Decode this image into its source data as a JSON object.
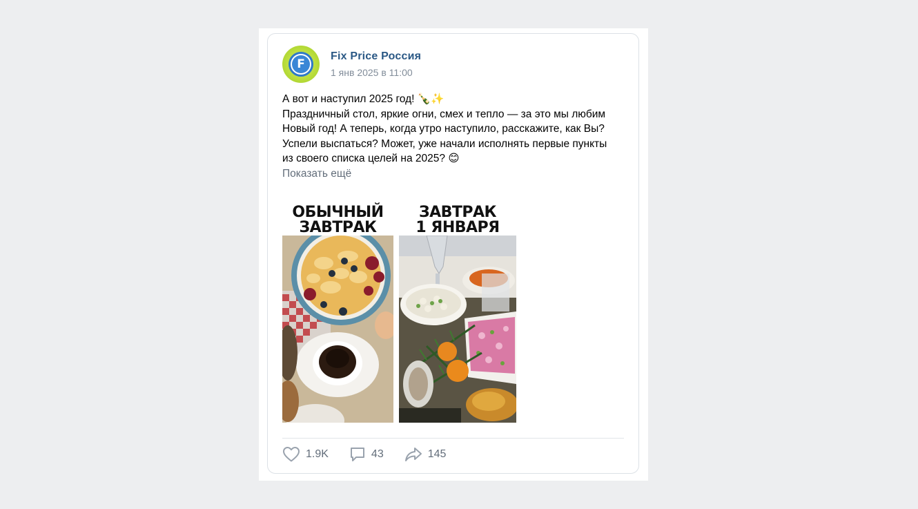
{
  "post": {
    "author": "Fix Price Россия",
    "date": "1 янв 2025 в 11:00",
    "avatar_letter": "F",
    "text_lines": [
      "А вот и наступил 2025 год! 🍾✨",
      "Праздничный стол, яркие огни, смех и тепло — за это мы любим",
      "Новый год! А теперь, когда утро наступило, расскажите, как Вы?",
      "Успели выспаться? Может, уже начали исполнять первые пункты",
      "из своего списка целей на 2025? 😊"
    ],
    "show_more": "Показать ещё",
    "images": [
      {
        "title_line1": "ОБЫЧНЫЙ",
        "title_line2": "ЗАВТРАК"
      },
      {
        "title_line1": "ЗАВТРАК",
        "title_line2": "1 ЯНВАРЯ"
      }
    ]
  },
  "actions": {
    "likes": "1.9K",
    "comments": "43",
    "shares": "145"
  },
  "colors": {
    "author": "#2a5885",
    "muted": "#818c99",
    "background": "#edeef0"
  },
  "icons": [
    "heart-icon",
    "comment-icon",
    "share-icon"
  ]
}
